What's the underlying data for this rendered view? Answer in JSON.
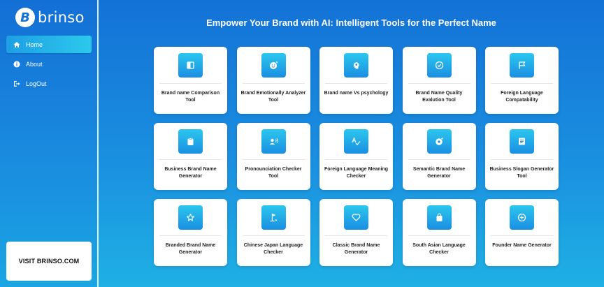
{
  "brand": {
    "logo_letter": "B",
    "name": "brinso"
  },
  "nav": [
    {
      "label": "Home",
      "icon": "home-icon"
    },
    {
      "label": "About",
      "icon": "info-icon"
    },
    {
      "label": "LogOut",
      "icon": "logout-icon"
    }
  ],
  "visit_label": "VISIT BRINSO.COM",
  "page_title": "Empower Your Brand with AI: Intelligent Tools for the Perfect Name",
  "tools": [
    {
      "label": "Brand name Comparison Tool",
      "icon": "compare-icon"
    },
    {
      "label": "Brand Emotionally Analyzer Tool",
      "icon": "emoji-icon"
    },
    {
      "label": "Brand name Vs psychology",
      "icon": "brain-icon"
    },
    {
      "label": "Brand Name Quality Evalution Tool",
      "icon": "check-circle-icon"
    },
    {
      "label": "Foreign Language Compatability",
      "icon": "flag-icon"
    },
    {
      "label": "Business Brand Name Generator",
      "icon": "clipboard-icon"
    },
    {
      "label": "Pronounciation Checker Tool",
      "icon": "speaker-icon"
    },
    {
      "label": "Foreign Language Meaning Checker",
      "icon": "spellcheck-icon"
    },
    {
      "label": "Semantic Brand Name Generator",
      "icon": "gear-icon"
    },
    {
      "label": "Business Slogan Generator Tool",
      "icon": "document-icon"
    },
    {
      "label": "Branded Brand Name Generator",
      "icon": "star-icon"
    },
    {
      "label": "Chinese Japan Language Checker",
      "icon": "golf-flag-icon"
    },
    {
      "label": "Classic Brand Name Generator",
      "icon": "heart-icon"
    },
    {
      "label": "South Asian Language Checker",
      "icon": "bag-icon"
    },
    {
      "label": "Founder Name Generator",
      "icon": "plus-circle-icon"
    }
  ]
}
